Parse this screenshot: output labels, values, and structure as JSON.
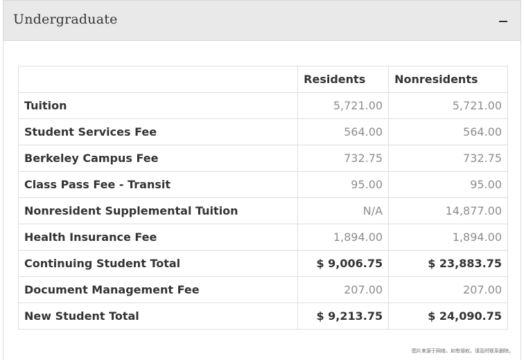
{
  "panel": {
    "title": "Undergraduate",
    "toggle_icon": "minus-icon"
  },
  "table": {
    "headers": [
      "",
      "Residents",
      "Nonresidents"
    ],
    "rows": [
      {
        "label": "Tuition",
        "residents": "5,721.00",
        "nonresidents": "5,721.00",
        "total": false
      },
      {
        "label": "Student Services Fee",
        "residents": "564.00",
        "nonresidents": "564.00",
        "total": false
      },
      {
        "label": "Berkeley Campus Fee",
        "residents": "732.75",
        "nonresidents": "732.75",
        "total": false
      },
      {
        "label": "Class Pass Fee - Transit",
        "residents": "95.00",
        "nonresidents": "95.00",
        "total": false
      },
      {
        "label": "Nonresident Supplemental Tuition",
        "residents": "N/A",
        "nonresidents": "14,877.00",
        "total": false
      },
      {
        "label": "Health Insurance Fee",
        "residents": "1,894.00",
        "nonresidents": "1,894.00",
        "total": false
      },
      {
        "label": "Continuing Student Total",
        "residents": "$ 9,006.75",
        "nonresidents": "$ 23,883.75",
        "total": true
      },
      {
        "label": "Document Management Fee",
        "residents": "207.00",
        "nonresidents": "207.00",
        "total": false
      },
      {
        "label": "New Student Total",
        "residents": "$ 9,213.75",
        "nonresidents": "$ 24,090.75",
        "total": true
      }
    ]
  },
  "watermark": "图片来源于网络，如有侵权，请及时联系删除。"
}
